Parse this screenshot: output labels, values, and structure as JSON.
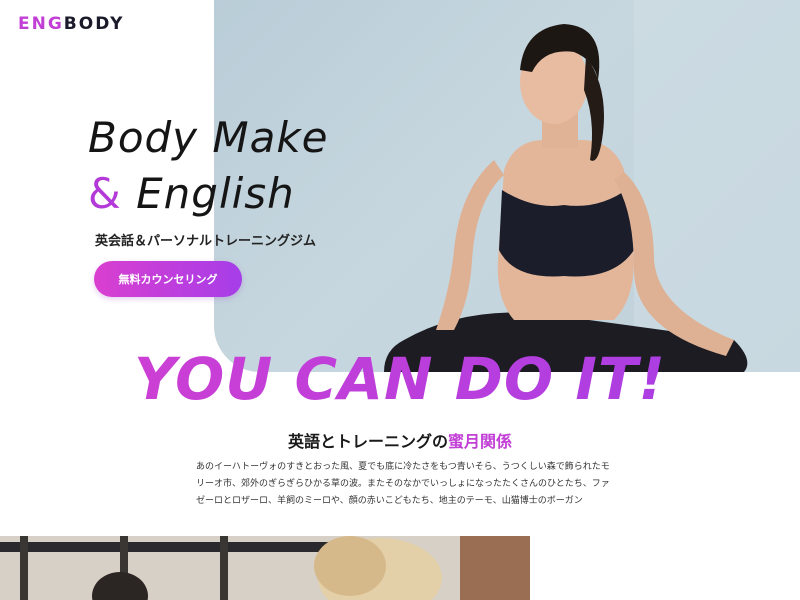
{
  "logo": {
    "part1": "ENG",
    "part2": "BODY"
  },
  "hero": {
    "line1": "Body Make",
    "amp": "&",
    "line2": "English",
    "subtitle": "英会話＆パーソナルトレーニングジム",
    "cta_label": "無料カウンセリング"
  },
  "slogan": "YOU CAN DO IT!",
  "section": {
    "title_pre": "英語とトレーニングの",
    "title_highlight": "蜜月関係",
    "paragraph": "あのイーハトーヴォのすきとおった風、夏でも底に冷たさをもつ青いそら、うつくしい森で飾られたモリーオ市、郊外のぎらぎらひかる草の波。またそのなかでいっしょになったたくさんのひとたち、ファゼーロとロザーロ、羊飼のミーロや、顔の赤いこどもたち、地主のテーモ、山猫博士のボーガン"
  },
  "colors": {
    "accent": "#c23fd6",
    "accent2": "#a63ee8",
    "hero_bg": "#c1d3dc"
  },
  "images": {
    "hero_photo": "woman-yoga-photo",
    "bottom_photo": "training-session-photo"
  }
}
